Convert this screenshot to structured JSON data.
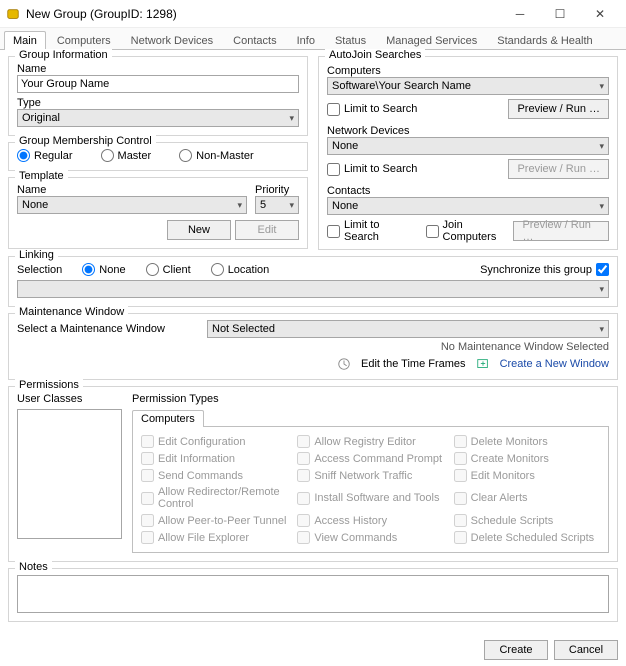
{
  "window": {
    "title": "New Group   (GroupID: 1298)"
  },
  "tabs": [
    "Main",
    "Computers",
    "Network Devices",
    "Contacts",
    "Info",
    "Status",
    "Managed Services",
    "Standards & Health"
  ],
  "activeTab": "Main",
  "groupInfo": {
    "legend": "Group Information",
    "nameLabel": "Name",
    "nameValue": "Your Group Name",
    "typeLabel": "Type",
    "typeValue": "Original"
  },
  "membership": {
    "legend": "Group Membership Control",
    "options": [
      "Regular",
      "Master",
      "Non-Master"
    ],
    "selected": "Regular"
  },
  "template": {
    "legend": "Template",
    "nameLabel": "Name",
    "nameValue": "None",
    "priorityLabel": "Priority",
    "priorityValue": "5",
    "newBtn": "New",
    "editBtn": "Edit"
  },
  "autojoin": {
    "legend": "AutoJoin Searches",
    "computersLabel": "Computers",
    "computersValue": "Software\\Your Search Name",
    "limitLabel": "Limit to Search",
    "previewBtn": "Preview / Run …",
    "netLabel": "Network Devices",
    "netValue": "None",
    "contactsLabel": "Contacts",
    "contactsValue": "None",
    "joinComputersLabel": "Join Computers"
  },
  "linking": {
    "legend": "Linking",
    "selectionLabel": "Selection",
    "options": [
      "None",
      "Client",
      "Location"
    ],
    "selected": "None",
    "syncLabel": "Synchronize this group"
  },
  "maint": {
    "legend": "Maintenance Window",
    "selectLabel": "Select a Maintenance Window",
    "selectValue": "Not Selected",
    "noSelected": "No Maintenance Window Selected",
    "editFrames": "Edit the Time Frames",
    "createNew": "Create a New Window"
  },
  "permissions": {
    "legend": "Permissions",
    "userClassesLabel": "User Classes",
    "permTypesLabel": "Permission Types",
    "permTab": "Computers",
    "items": [
      "Edit Configuration",
      "Allow Registry Editor",
      "Delete Monitors",
      "Edit Information",
      "Access Command Prompt",
      "Create Monitors",
      "Send Commands",
      "Sniff Network Traffic",
      "Edit Monitors",
      "Allow Redirector/Remote Control",
      "Install Software and Tools",
      "Clear Alerts",
      "Allow Peer-to-Peer Tunnel",
      "Access History",
      "Schedule Scripts",
      "Allow File Explorer",
      "View Commands",
      "Delete Scheduled Scripts"
    ]
  },
  "notes": {
    "legend": "Notes"
  },
  "footer": {
    "create": "Create",
    "cancel": "Cancel"
  }
}
